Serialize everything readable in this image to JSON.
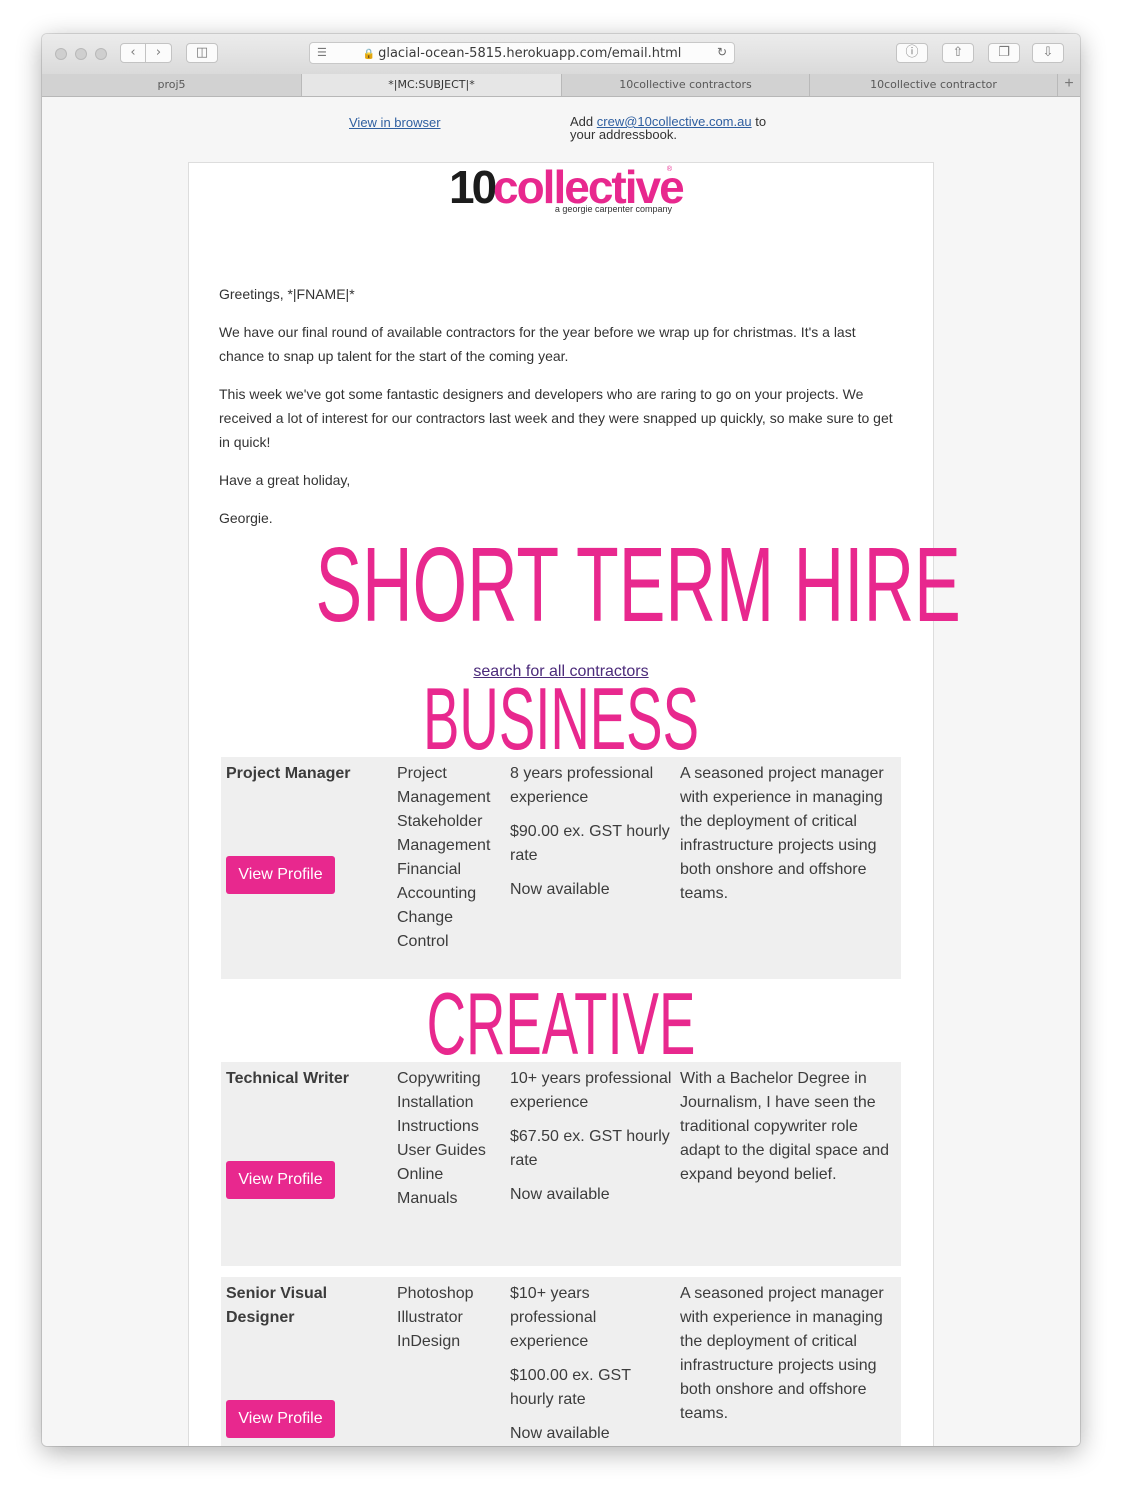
{
  "browser": {
    "url": "glacial-ocean-5815.herokuapp.com/email.html",
    "tabs": [
      {
        "label": "proj5"
      },
      {
        "label": "*|MC:SUBJECT|*"
      },
      {
        "label": "10collective contractors"
      },
      {
        "label": "10collective contractor"
      }
    ]
  },
  "preheader": {
    "view_in_browser": "View in browser",
    "add_prefix": "Add",
    "email": "crew@10collective.com.au",
    "add_suffix": "to your addressbook."
  },
  "logo": {
    "part1": "10",
    "part2": "collective",
    "reg": "®",
    "tagline": "a georgie carpenter company"
  },
  "greeting": "Greetings, *|FNAME|*",
  "paragraphs": [
    "We have our final round of available contractors for the year before we wrap up for christmas. It's a last chance to snap up talent for the start of the coming year.",
    "This week we've got some fantastic designers and developers who are raring to go on your projects. We received a lot of interest for our contractors last week and they were snapped up quickly, so make sure to get in quick!",
    "Have a great holiday,",
    "Georgie."
  ],
  "hero_heading": "SHORT TERM HIRE",
  "search_link": "search for all contractors",
  "sections": [
    {
      "heading": "BUSINESS",
      "contractors": [
        {
          "role": "Project Manager",
          "skills": "Project Management Stakeholder Management Financial Accounting Change Control",
          "experience": "8 years professional experience",
          "rate": "$90.00 ex. GST hourly rate",
          "availability": "Now available",
          "bio": "A seasoned project manager with experience in managing the deployment of critical infrastructure projects using both onshore and offshore teams.",
          "button": "View Profile"
        }
      ]
    },
    {
      "heading": "CREATIVE",
      "contractors": [
        {
          "role": "Technical Writer",
          "skills": "Copywriting Installation Instructions User Guides Online Manuals",
          "experience": "10+ years professional experience",
          "rate": "$67.50 ex. GST hourly rate",
          "availability": "Now available",
          "bio": "With a Bachelor Degree in Journalism, I have seen the traditional copywriter role adapt to the digital space and expand beyond belief.",
          "button": "View Profile"
        },
        {
          "role": "Senior Visual Designer",
          "skills": "Photoshop Illustrator InDesign",
          "experience": "$10+ years professional experience",
          "rate": "$100.00 ex. GST hourly rate",
          "availability": "Now available",
          "bio": "A seasoned project manager with experience in managing the deployment of critical infrastructure projects using both onshore and offshore teams.",
          "button": "View Profile"
        }
      ]
    }
  ],
  "colors": {
    "brand_pink": "#e8288e",
    "card_bg": "#efefef",
    "link_blue": "#2f5fa0"
  }
}
